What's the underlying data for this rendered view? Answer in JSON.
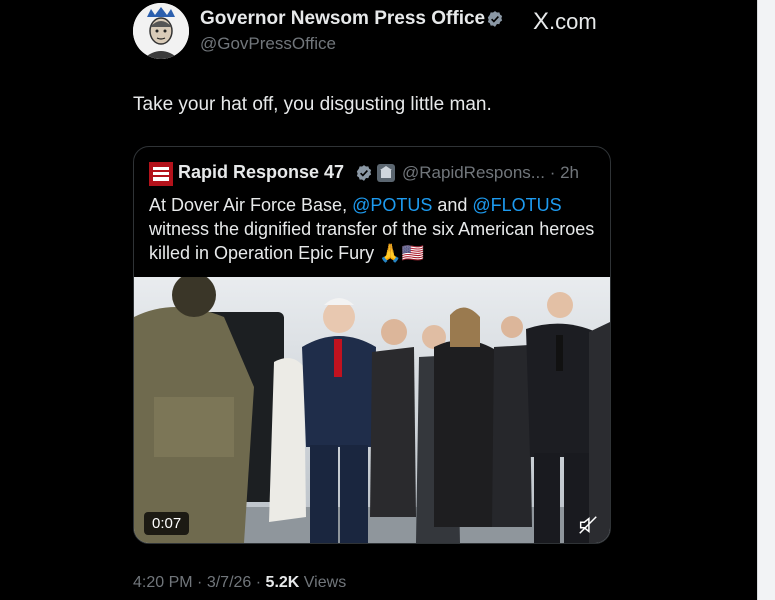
{
  "post": {
    "author_name": "Governor Newsom Press Office",
    "author_handle": "@GovPressOffice",
    "site_label": ".com",
    "site_logo": "X",
    "text": "Take your hat off, you disgusting little man."
  },
  "quote": {
    "author_name": "Rapid Response 47",
    "author_handle": "@RapidRespons...",
    "time_separator": "·",
    "time": "2h",
    "text_before_1": "At Dover Air Force Base, ",
    "mention_1": "@POTUS",
    "text_between": " and ",
    "mention_2": "@FLOTUS",
    "text_after": " witness the dignified transfer of the six American heroes killed in Operation Epic Fury ",
    "emoji": "🙏🇺🇸",
    "video_duration": "0:07"
  },
  "meta": {
    "time": "4:20 PM",
    "separator": "·",
    "date": "3/7/26",
    "views_count": "5.2K",
    "views_label": "Views"
  },
  "colors": {
    "accent": "#1d9bf0",
    "background": "#000000",
    "secondary_text": "#71767b"
  }
}
